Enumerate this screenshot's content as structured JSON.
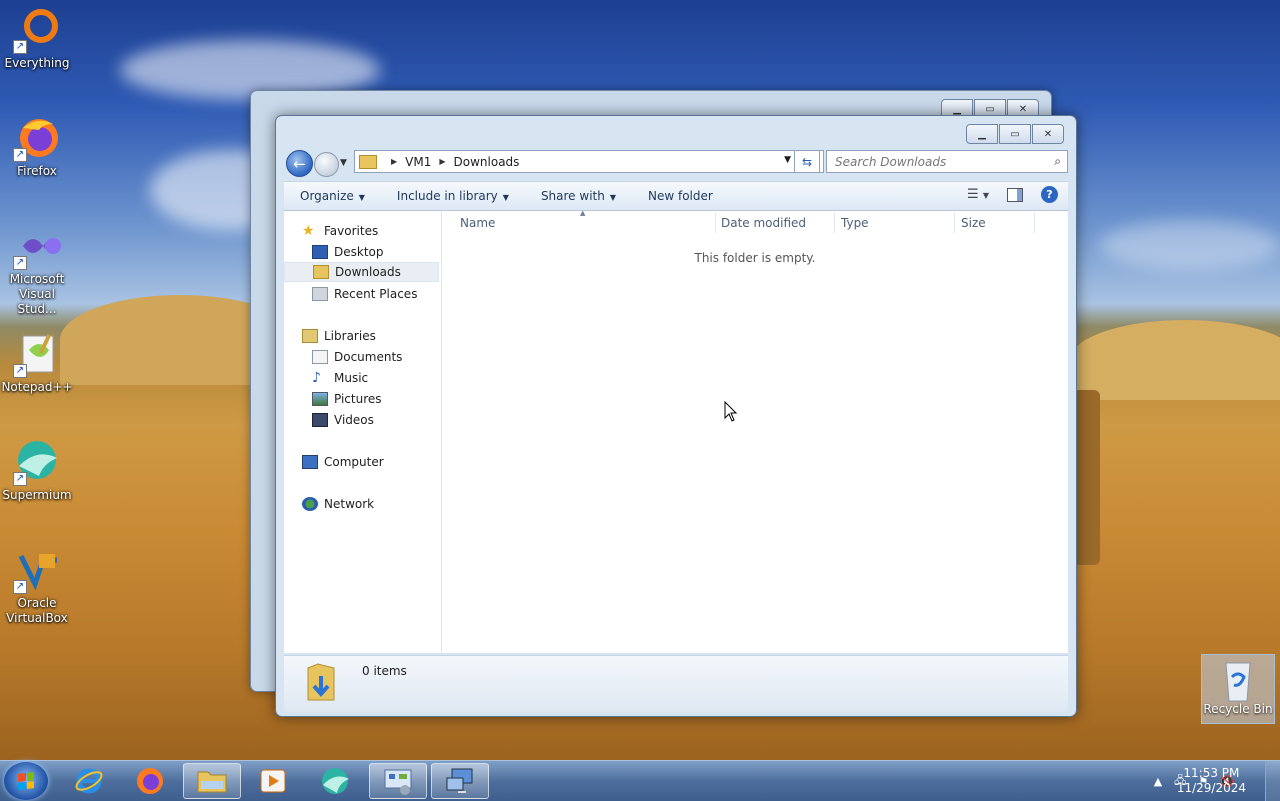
{
  "desktop": {
    "icons": [
      {
        "label": "Everything",
        "icon": "everything-icon"
      },
      {
        "label": "Firefox",
        "icon": "firefox-icon"
      },
      {
        "label": "Microsoft Visual Stud...",
        "icon": "visual-studio-icon"
      },
      {
        "label": "Notepad++",
        "icon": "notepad-plus-plus-icon"
      },
      {
        "label": "Supermium",
        "icon": "supermium-icon"
      },
      {
        "label": "Oracle VirtualBox",
        "icon": "virtualbox-icon"
      }
    ],
    "recycle_bin": {
      "label": "Recycle Bin"
    }
  },
  "explorer": {
    "address": {
      "root": "VM1",
      "current": "Downloads"
    },
    "search": {
      "placeholder": "Search Downloads"
    },
    "commands": {
      "organize": "Organize",
      "include_in_library": "Include in library",
      "share_with": "Share with",
      "new_folder": "New folder"
    },
    "nav": {
      "favorites": "Favorites",
      "desktop": "Desktop",
      "downloads": "Downloads",
      "recent_places": "Recent Places",
      "libraries": "Libraries",
      "documents": "Documents",
      "music": "Music",
      "pictures": "Pictures",
      "videos": "Videos",
      "computer": "Computer",
      "network": "Network"
    },
    "columns": {
      "name": "Name",
      "date_modified": "Date modified",
      "type": "Type",
      "size": "Size"
    },
    "empty_message": "This folder is empty.",
    "status": {
      "item_count": "0 items"
    }
  },
  "taskbar": {
    "clock": {
      "time": "11:53 PM",
      "date": "11/29/2024"
    }
  },
  "colors": {
    "accent": "#2d66c2",
    "taskbar": "#4e6f9d"
  }
}
